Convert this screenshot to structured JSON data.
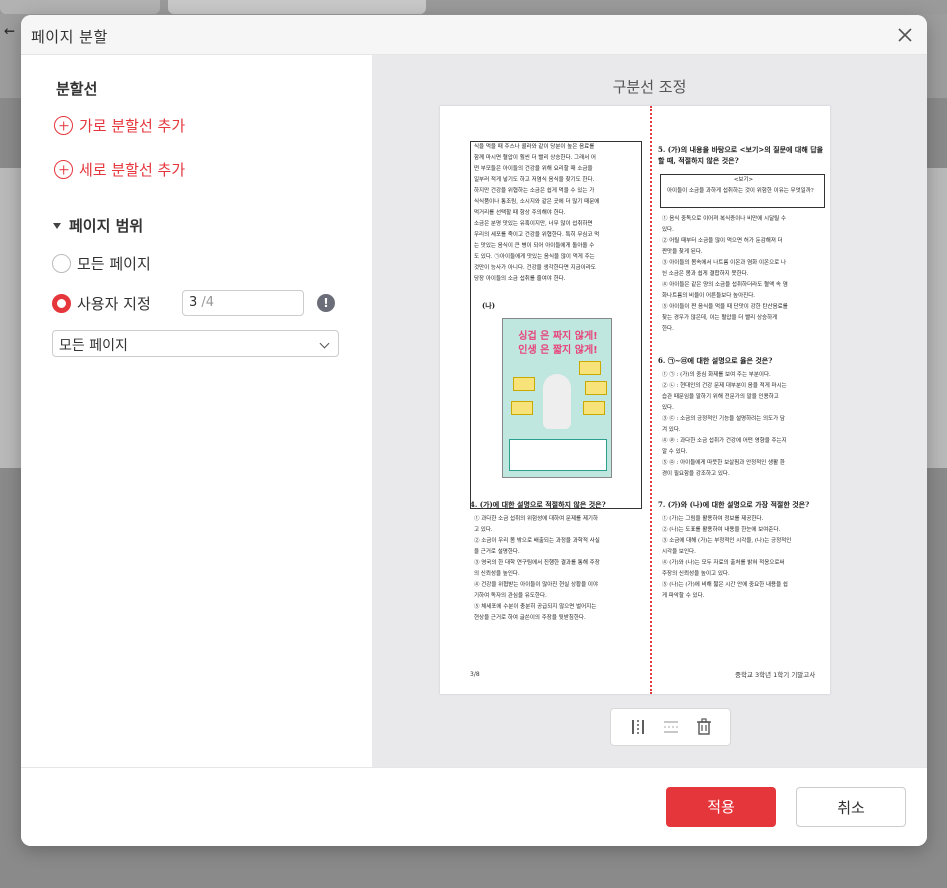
{
  "dialog": {
    "title": "페이지 분할",
    "close_icon": "close-icon"
  },
  "split_lines": {
    "heading": "분할선",
    "add_horizontal": "가로 분할선 추가",
    "add_vertical": "세로 분할선 추가"
  },
  "page_range": {
    "heading": "페이지 범위",
    "all_pages": "모든 페이지",
    "custom": "사용자 지정",
    "custom_selected": true,
    "page_input_value": "3",
    "page_input_total": "/4",
    "info_icon": "!",
    "dropdown_value": "모든 페이지"
  },
  "preview": {
    "heading": "구분선 조정",
    "page_text": {
      "left_paragraph": [
        "식을 먹을 때 주스나 콜라와 같이 당분이 높은 음료를",
        "함께 마시면 혈압이 훨씬 더 빨리 상승한다. 그래서 어",
        "떤 부모들은 아이들의 건강을 위해 요리할 때 소금을",
        "일부러 적게 넣기도 하고 저염식 음식을 찾기도 한다.",
        "하지만 건강을 위협하는 소금은 쉽게 먹을 수 있는 가",
        "식식품이나 통조림, 소시지와 같은 곳에 더 많기 때문에",
        "먹거리를 선택할 때 항상 주의해야 한다.",
        "소금은 분명 맛있는 유혹이지만, 너무 많이 섭취하면",
        "우리의 세포를 죽이고 건강을 위협한다. 특히 무심코 먹",
        "는 맛있는 음식이 큰 병이 되어 아이들에게 돌아올 수",
        "도 있다. ㉠아이들에게 맛있는 음식을 많이 먹게 주는",
        "것만이 능사가 아니다. 건강을 생각한다면 지금이라도",
        "당장 아이들의 소금 섭취를 줄여야 한다."
      ],
      "label_na": "(나)",
      "poster_line1": "싱겁 은 짜지 않게!",
      "poster_line2": "인생 은 짧지 않게!",
      "q4": "4. (가)에 대한 설명으로 적절하지 않은 것은?",
      "q4_options": [
        "① 과다한 소금 섭취의 위험성에 대하여 문제를 제기하",
        "고 있다.",
        "② 소금이 우리 몸 밖으로 배출되는 과정을 과학적 사실",
        "을 근거로 설명한다.",
        "③ 영국의 한 대학 연구팀에서 진행한 결과를 통해 주장",
        "의 신뢰성을 높인다.",
        "④ 건강을 위협받는 아이들이 많아진 현실 상황을 이야",
        "기하여 독자의 관심을 유도한다.",
        "⑤ 체세포에 수분이 충분히 공급되지 않으면 벌어지는",
        "현상을 근거로 하여 글쓴이의 주장을 뒷받침한다."
      ],
      "q5": "5. (가)의 내용을 바탕으로 <보기>의 질문에 대해 답을 할 때, 적절하지 않은 것은?",
      "q5_box_label": "<보기>",
      "q5_box_text": "아이들이 소금을 과하게 섭취하는 것이 위험한 이유는 무엇일까?",
      "q5_options": [
        "① 음식 중독으로 이어져 복식증이나 비만에 시달릴 수",
        "있다.",
        "② 어릴 때부터 소금을 많이 먹으면 허가 둔감해져 더",
        "짠맛을 찾게 된다.",
        "③ 아이들의 몸속에서 나트륨 이온과 염화 이온으로 나",
        "뉜 소금은 몸과 쉽게 결합하지 못한다.",
        "④ 아이들은 같은 양의 소금을 섭취하더라도 혈액 속 염",
        "화나트륨의 비율이 어른들보다 높아진다.",
        "⑤ 아이들이 짠 음식을 먹을 때 단맛이 강한 탄산음료를",
        "찾는 경우가 많은데, 이는 혈압을 더 빨리 상승하게",
        "한다."
      ],
      "q6": "6. ㉠~㉤에 대한 설명으로 옳은 것은?",
      "q6_options": [
        "① ㉠ : (가)의 중심 화제를 보여 주는 부분이다.",
        "② ㉡ : 현대인의 건강 문제 대부분이 음을 적게 마시는",
        "습관 때문임을 말하기 위해 전문가의 말을 인용하고",
        "있다.",
        "③ ㉢ : 소금의 긍정적인 기능을 설명하려는 의도가 담",
        "겨 있다.",
        "④ ㉣ : 과다한 소금 섭취가 건강에 어떤 영향을 주는지",
        "알 수 있다.",
        "⑤ ㉤ : 아이들에게 따뜻한 보살핌과 안정적인 생활 환",
        "경이 필요함을 강조하고 있다."
      ],
      "q7": "7. (가)와 (나)에 대한 설명으로 가장 적절한 것은?",
      "q7_options": [
        "① (가)는 그림을 활용하여 정보를 제공한다.",
        "② (나)는 도표를 활용하여 내용을 한눈에 보여준다.",
        "③ 소금에 대해 (가)는 부정적인 시각을, (나)는 긍정적인",
        "시각을 보인다.",
        "④ (가)와 (나)는 모두 자료의 출처를 밝혀 적응으로써",
        "주장의 신뢰성을 높이고 있다.",
        "⑤ (나)는 (가)에 비해 짧은 시간 안에 중요한 내용을 쉽",
        "게 파악할 수 있다."
      ],
      "page_number": "3/8",
      "footer_title": "중학교 3학년 1학기 기말고사"
    }
  },
  "buttons": {
    "apply": "적용",
    "cancel": "취소"
  },
  "colors": {
    "accent": "#e5363c",
    "panel_bg": "#e9e9ec"
  }
}
